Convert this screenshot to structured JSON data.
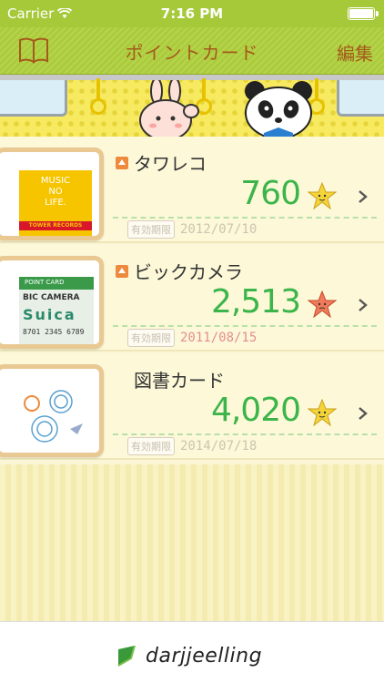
{
  "status_bar": {
    "carrier": "Carrier",
    "time": "7:16 PM"
  },
  "nav": {
    "title": "ポイントカード",
    "edit_label": "編集",
    "book_icon": "book-icon"
  },
  "cards": [
    {
      "name": "タワレコ",
      "points": "760",
      "expiry_label": "有効期限",
      "expiry_date": "2012/07/10",
      "expired": false,
      "star_color": "#f5d43a",
      "has_marker": true,
      "thumb": {
        "line1": "MUSIC",
        "line2": "NO",
        "line3": "LIFE.",
        "brand": "TOWER RECORDS"
      }
    },
    {
      "name": "ビックカメラ",
      "points": "2,513",
      "expiry_label": "有効期限",
      "expiry_date": "2011/08/15",
      "expired": true,
      "star_color": "#f07a5a",
      "has_marker": true,
      "thumb": {
        "header": "POINT CARD",
        "line1": "BIC CAMERA",
        "line2": "Suica",
        "line3": "8701 2345 6789"
      }
    },
    {
      "name": "図書カード",
      "points": "4,020",
      "expiry_label": "有効期限",
      "expiry_date": "2014/07/18",
      "expired": false,
      "star_color": "#f5d43a",
      "has_marker": false,
      "thumb": {}
    }
  ],
  "footer": {
    "brand": "darjjeelling"
  },
  "colors": {
    "nav_green": "#abcb3f",
    "title_brown": "#a45a1a",
    "points_green": "#3bb54a",
    "expired_red": "#e58e8e"
  }
}
